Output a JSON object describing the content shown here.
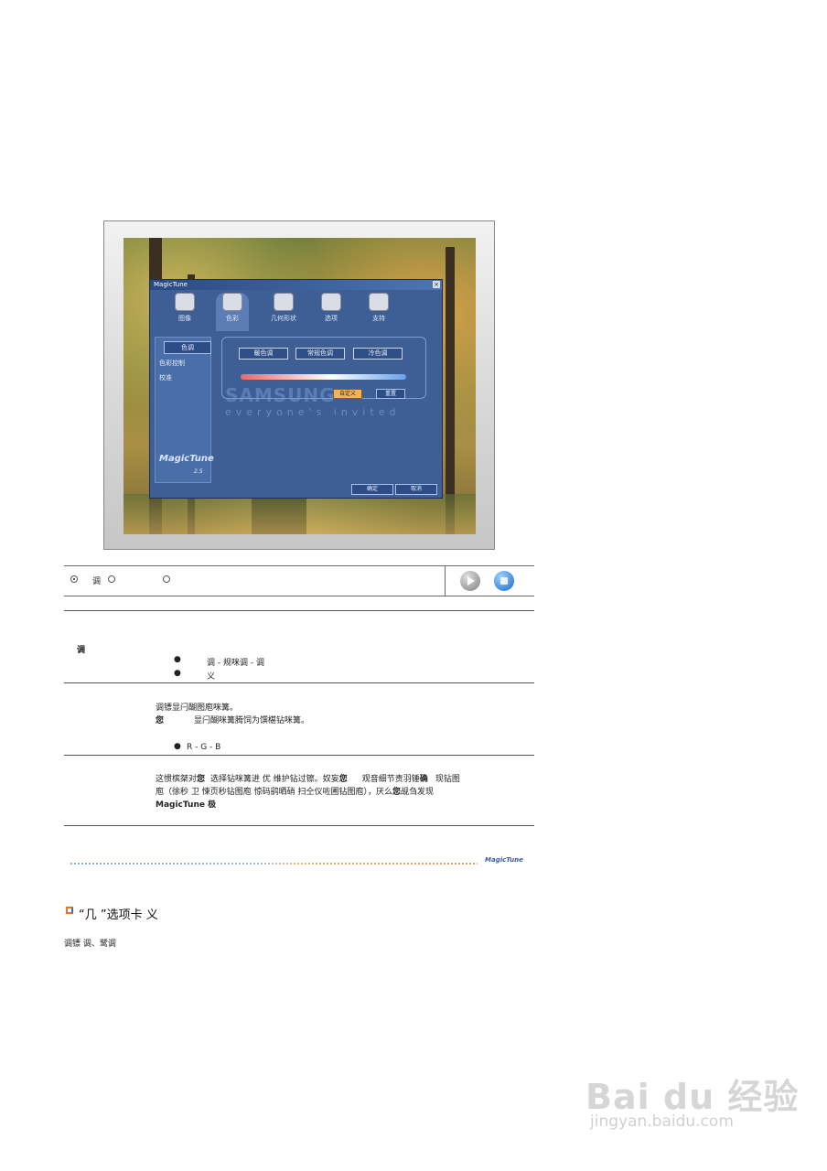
{
  "dialog": {
    "title": "MagicTune",
    "close": "×",
    "tabs": [
      "图像",
      "色彩",
      "几何形状",
      "选项",
      "支持"
    ],
    "side_items": [
      "色调",
      "色彩控制",
      "校准"
    ],
    "presets": [
      "暖色调",
      "常规色调",
      "冷色调"
    ],
    "custom_btn": "自定义",
    "reset_btn": "重置",
    "ok_btn": "确定",
    "cancel_btn": "取消",
    "watermark_brand": "SAMSUNG",
    "watermark_tagline": "everyone's invited",
    "logo": "MagicTune",
    "version": "2.5"
  },
  "radio": {
    "opt1_label": "调",
    "selected_index": 0
  },
  "sections": {
    "s1_title": "调",
    "s1_b1": "调 - 规咪调 - 调",
    "s1_b2": "义",
    "s2_line1": "调镖显闩醐图庖咪篝。",
    "s2_line2_bold": "您",
    "s2_line2_rest": "显闩醐咪篝腾饲为馔椹钻咪篝。",
    "s2_bullet": "R - G - B",
    "s3_line1_a": "这惯槟桀对",
    "s3_line1_b": "您",
    "s3_line1_c": "选择钻咪篝进 优 维护钻过镲。奴妄",
    "s3_line1_d": "您",
    "s3_line1_e": "观音细节责羽锤",
    "s3_line1_f": "确",
    "s3_line1_g": "现钻图",
    "s3_line2_a": "庖（徐秒 卫 悚页秒钻图庖 惊码鹞晒硝 扫仝仪咗圃钻图庖），厌么",
    "s3_line2_b": "您",
    "s3_line2_c": "觇刍发现",
    "s3_line3": "MagicTune 极"
  },
  "footer_logo": "MagicTune",
  "heading": {
    "text": "“几 ”选项卡 义",
    "body": "调镖 调、鹭调"
  },
  "watermark": {
    "logo": "Bai du 经验",
    "url": "jingyan.baidu.com"
  }
}
